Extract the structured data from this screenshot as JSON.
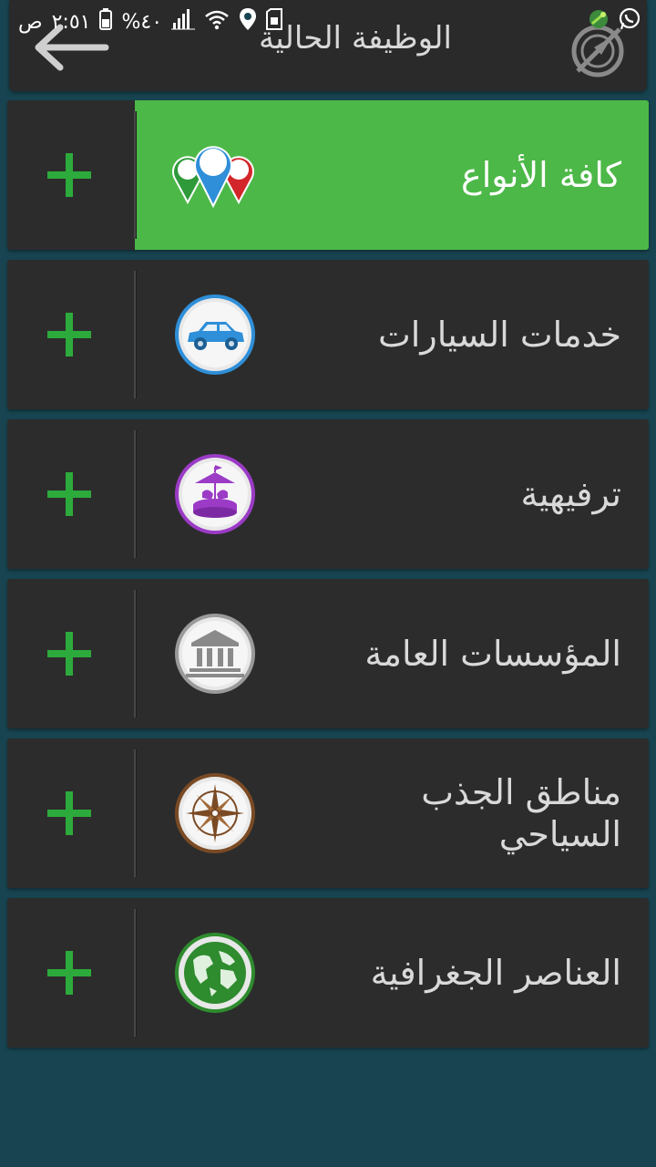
{
  "status_bar": {
    "time": "٢:٥١",
    "am_pm": "ص",
    "battery": "%٤٠"
  },
  "header": {
    "title": "الوظيفة الحالية"
  },
  "categories": [
    {
      "label": "كافة الأنواع",
      "icon": "multi-pin-icon",
      "selected": true
    },
    {
      "label": "خدمات السيارات",
      "icon": "car-icon",
      "color": "#2f8fd8",
      "selected": false
    },
    {
      "label": "ترفيهية",
      "icon": "carousel-icon",
      "color": "#9b3bc6",
      "selected": false
    },
    {
      "label": "المؤسسات العامة",
      "icon": "bank-icon",
      "color": "#9a9a9a",
      "selected": false
    },
    {
      "label": "مناطق الجذب السياحي",
      "icon": "compass-rose-icon",
      "color": "#7a4a24",
      "selected": false
    },
    {
      "label": "العناصر الجغرافية",
      "icon": "globe-icon",
      "color": "#2e8b2e",
      "selected": false
    }
  ],
  "colors": {
    "background": "#174450",
    "active_row": "#4cb848",
    "row": "#2c2c2c",
    "plus": "#2daa3c"
  }
}
